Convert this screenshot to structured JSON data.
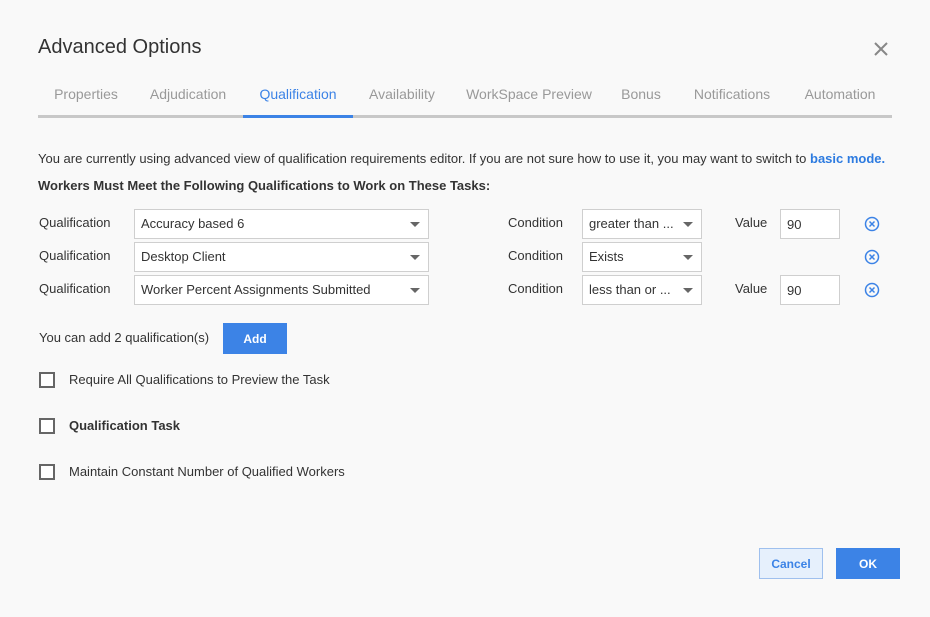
{
  "dialog": {
    "title": "Advanced Options"
  },
  "tabs": [
    {
      "label": "Properties"
    },
    {
      "label": "Adjudication"
    },
    {
      "label": "Qualification",
      "active": true
    },
    {
      "label": "Availability"
    },
    {
      "label": "WorkSpace Preview"
    },
    {
      "label": "Bonus"
    },
    {
      "label": "Notifications"
    },
    {
      "label": "Automation"
    }
  ],
  "info": {
    "text": "You are currently using advanced view of qualification requirements editor. If you are not sure how to use it, you may want to switch to",
    "link": "basic mode."
  },
  "subheading": "Workers Must Meet the Following Qualifications to Work on These Tasks:",
  "qualifications": [
    {
      "qual_label": "Qualification",
      "qual_value": "Accuracy based 6",
      "cond_label": "Condition",
      "cond_value": "greater than ...",
      "value_label": "Value",
      "value": "90"
    },
    {
      "qual_label": "Qualification",
      "qual_value": "Desktop Client",
      "cond_label": "Condition",
      "cond_value": "Exists"
    },
    {
      "qual_label": "Qualification",
      "qual_value": "Worker Percent Assignments Submitted",
      "cond_label": "Condition",
      "cond_value": "less than or ...",
      "value_label": "Value",
      "value": "90"
    }
  ],
  "add": {
    "text": "You can add 2 qualification(s)",
    "button": "Add"
  },
  "options": [
    {
      "label": "Require All Qualifications to Preview the Task",
      "checked": false
    },
    {
      "label": "Qualification Task",
      "checked": false
    },
    {
      "label": "Maintain Constant Number of Qualified Workers",
      "checked": false
    }
  ],
  "footer": {
    "cancel": "Cancel",
    "ok": "OK"
  },
  "colors": {
    "accent": "#3c83e6",
    "tab_inactive": "#999999",
    "background": "#f9f9f9"
  }
}
